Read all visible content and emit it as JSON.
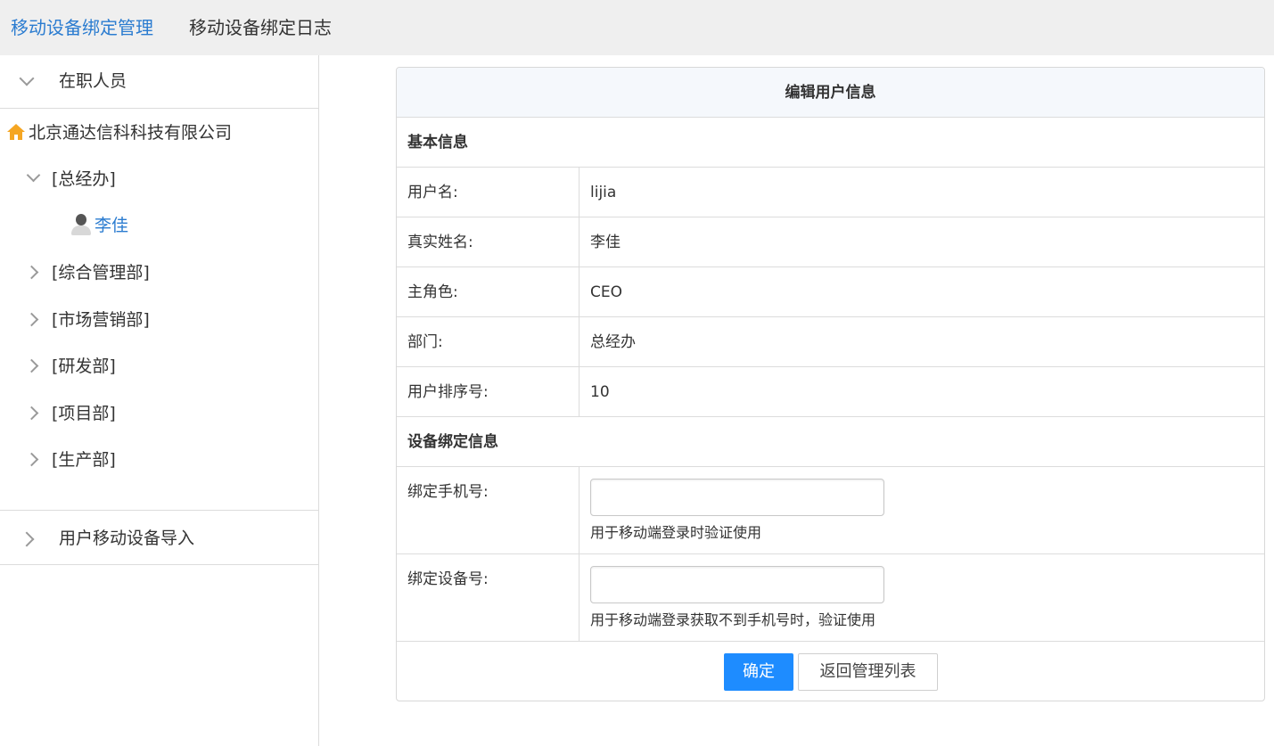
{
  "tabs": [
    {
      "label": "移动设备绑定管理",
      "active": true
    },
    {
      "label": "移动设备绑定日志",
      "active": false
    }
  ],
  "sidebar": {
    "section1": {
      "label": "在职人员",
      "expanded": true
    },
    "root": {
      "label": "北京通达信科科技有限公司",
      "icon": "home-icon"
    },
    "nodes": [
      {
        "label": "[总经办]",
        "expanded": true
      },
      {
        "label": "[综合管理部]",
        "expanded": false
      },
      {
        "label": "[市场营销部]",
        "expanded": false
      },
      {
        "label": "[研发部]",
        "expanded": false
      },
      {
        "label": "[项目部]",
        "expanded": false
      },
      {
        "label": "[生产部]",
        "expanded": false
      }
    ],
    "leaf": {
      "label": "李佳",
      "icon": "user-icon"
    },
    "section2": {
      "label": "用户移动设备导入",
      "expanded": false
    }
  },
  "form": {
    "title": "编辑用户信息",
    "group_basic": "基本信息",
    "fields": [
      {
        "label": "用户名:",
        "value": "lijia"
      },
      {
        "label": "真实姓名:",
        "value": "李佳"
      },
      {
        "label": "主角色:",
        "value": "CEO"
      },
      {
        "label": "部门:",
        "value": "总经办"
      },
      {
        "label": "用户排序号:",
        "value": "10"
      }
    ],
    "group_device": "设备绑定信息",
    "phone": {
      "label": "绑定手机号:",
      "value": "",
      "hint": "用于移动端登录时验证使用"
    },
    "device": {
      "label": "绑定设备号:",
      "value": "",
      "hint": "用于移动端登录获取不到手机号时，验证使用"
    },
    "confirm_label": "确定",
    "back_label": "返回管理列表"
  },
  "colors": {
    "accent": "#2b7cd0",
    "primary_button": "#1e8cff",
    "home_icon": "#f5a623"
  }
}
